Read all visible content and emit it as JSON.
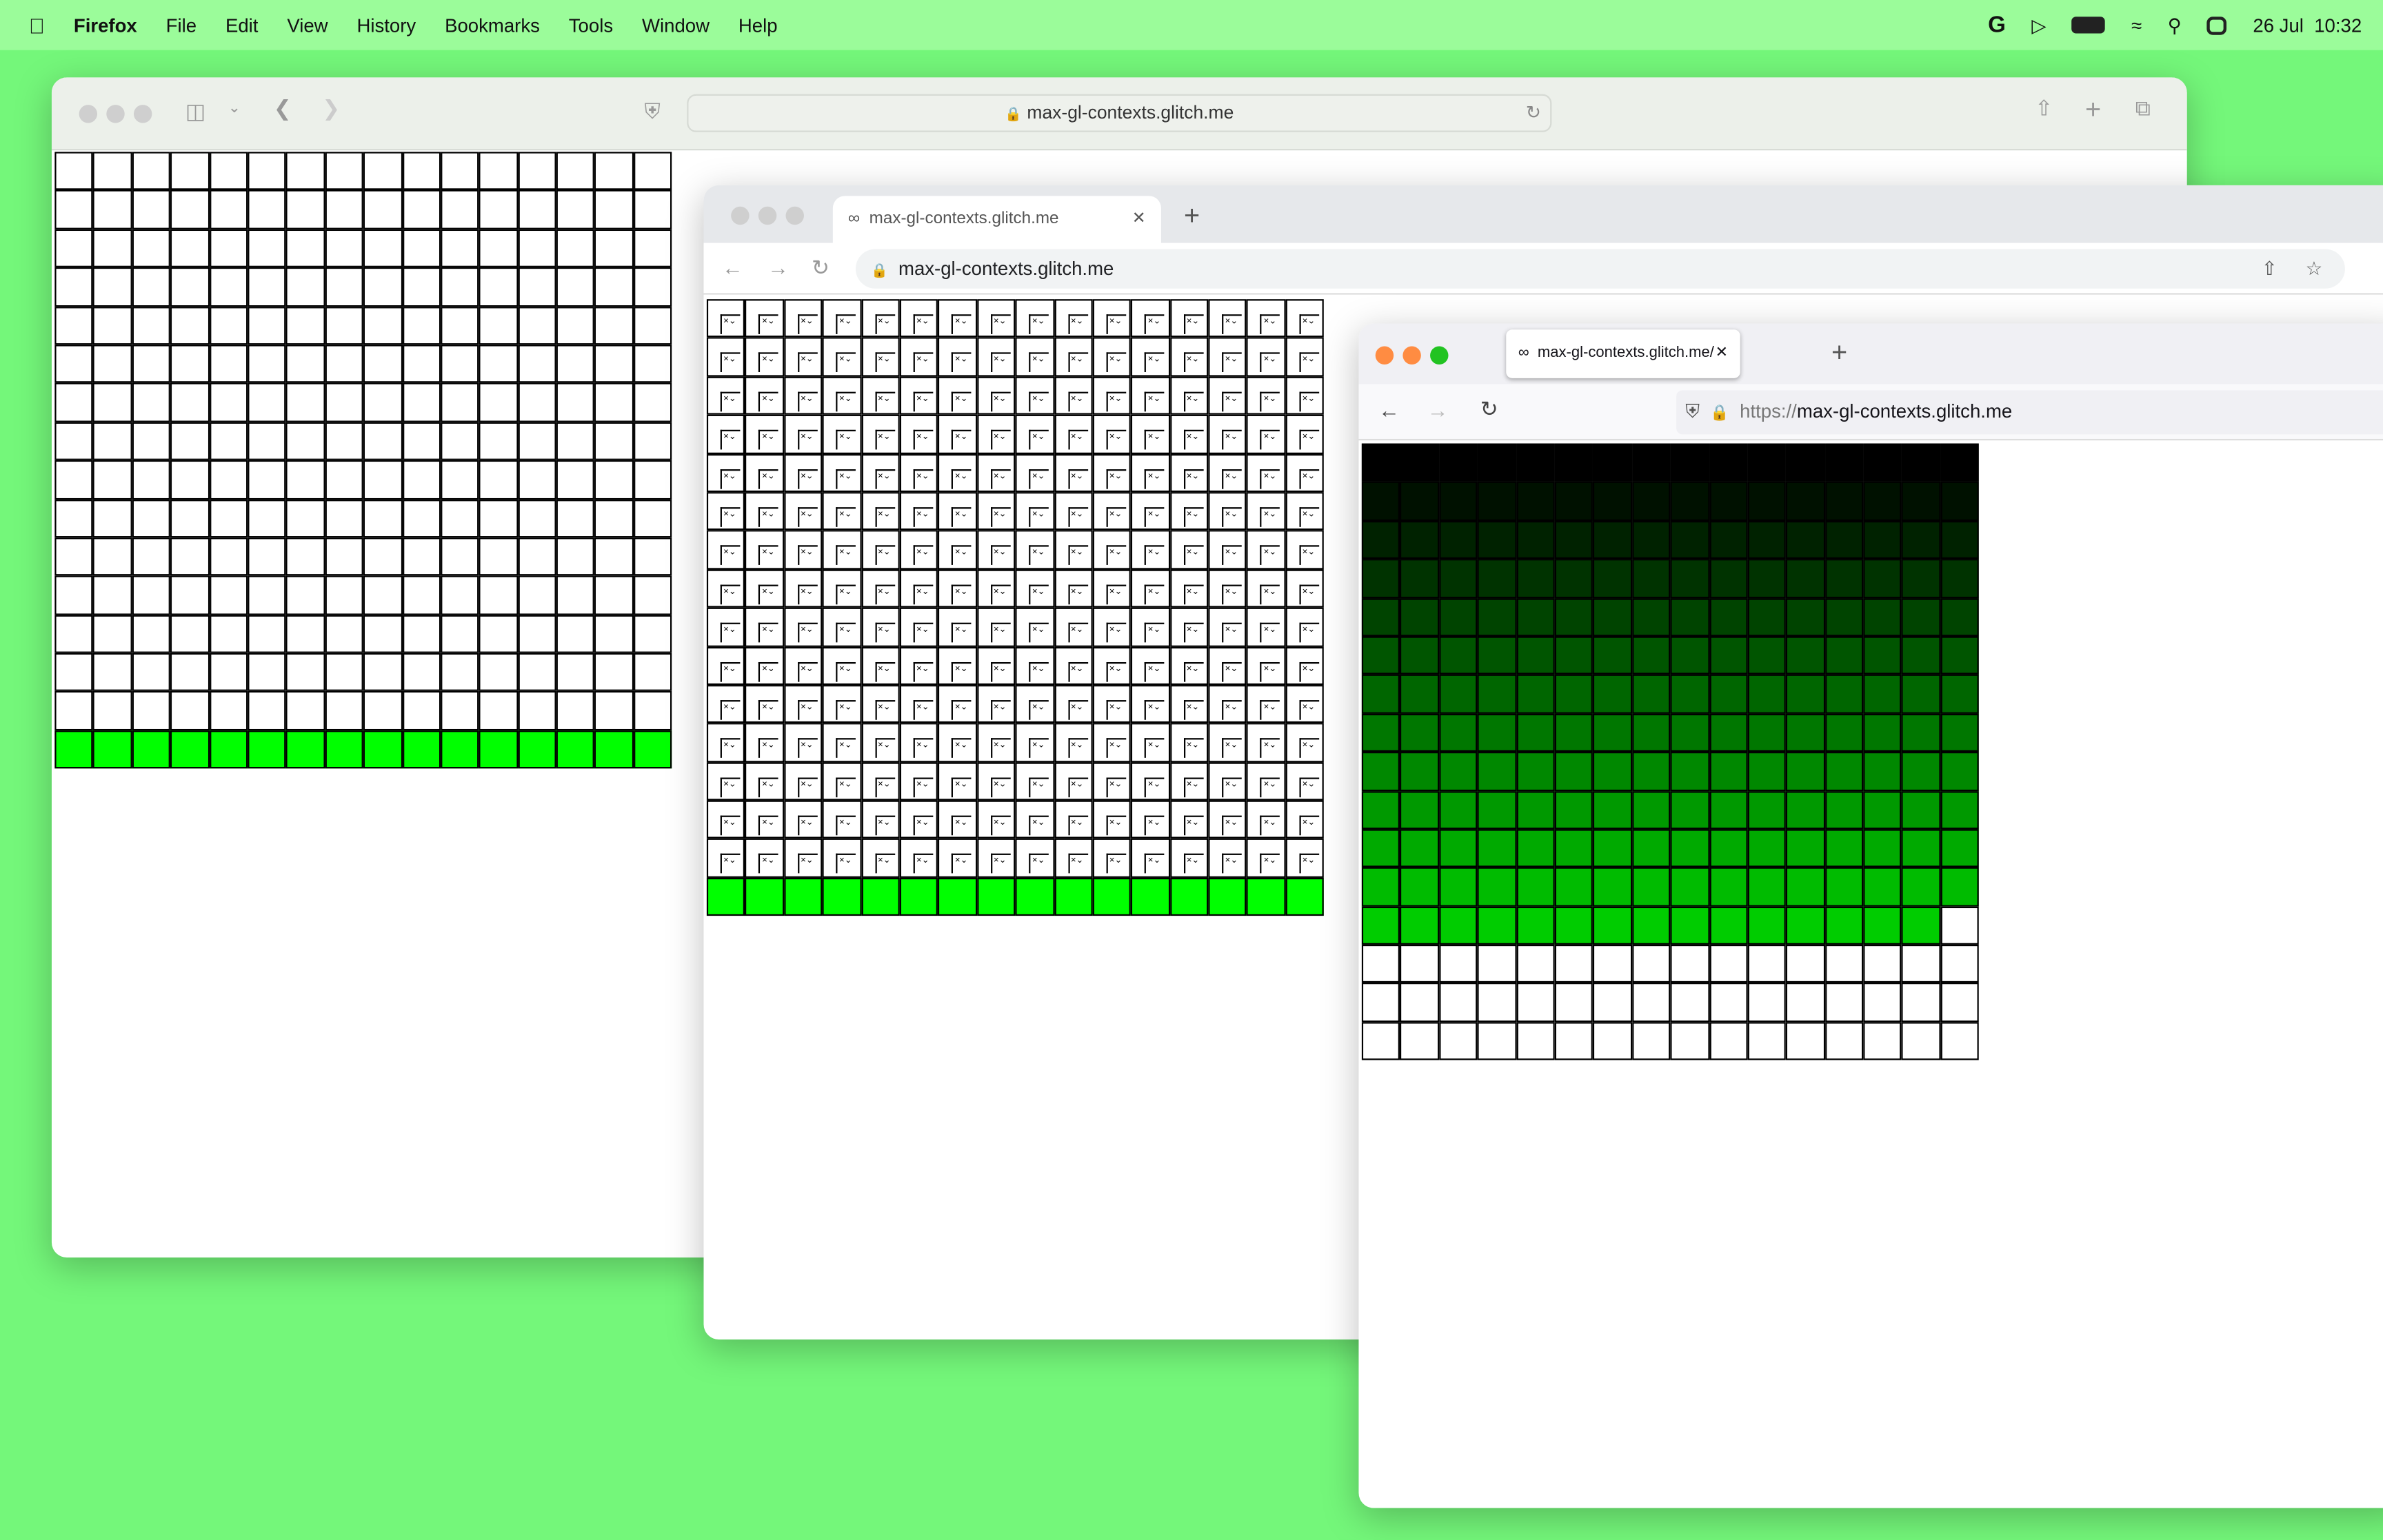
{
  "menubar": {
    "app": "Firefox",
    "items": [
      "File",
      "Edit",
      "View",
      "History",
      "Bookmarks",
      "Tools",
      "Window",
      "Help"
    ],
    "date": "26 Jul",
    "time": "10:32",
    "icons": [
      "google-icon",
      "play-icon",
      "battery-charging-icon",
      "wifi-icon",
      "search-icon",
      "control-center-icon"
    ]
  },
  "safari": {
    "url": "max-gl-contexts.glitch.me",
    "grid": {
      "cols": 16,
      "rows": 16,
      "blank_rows": 15,
      "green_rows": 1,
      "cell_color": "#00ff00"
    }
  },
  "chrome": {
    "tab_title": "max-gl-contexts.glitch.me",
    "url": "max-gl-contexts.glitch.me",
    "grid": {
      "cols": 16,
      "rows": 16,
      "broken_rows": 15,
      "green_rows": 1,
      "cell_color": "#00ff00"
    }
  },
  "firefox": {
    "tab_title": "max-gl-contexts.glitch.me/",
    "url_scheme": "https://",
    "url_host": "max-gl-contexts.glitch.me",
    "grid": {
      "cols": 16,
      "rows": 16,
      "filled_cells": 207,
      "gradient_start": "#000000",
      "gradient_end": "#00cc00"
    }
  },
  "colors": {
    "desktop": "#74f77a",
    "menubar": "#9bfc9a"
  }
}
